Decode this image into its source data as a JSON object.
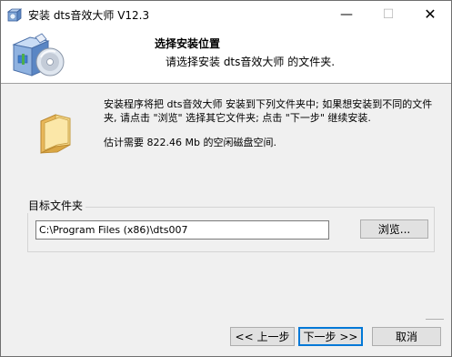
{
  "window": {
    "title": "安装 dts音效大师 V12.3",
    "minimize_glyph": "—",
    "maximize_glyph": "☐",
    "close_glyph": "✕"
  },
  "header": {
    "title": "选择安装位置",
    "subtitle": "请选择安装 dts音效大师 的文件夹."
  },
  "body": {
    "description": "安装程序将把 dts音效大师 安装到下列文件夹中; 如果想安装到不同的文件夹, 请点击 \"浏览\" 选择其它文件夹; 点击 \"下一步\" 继续安装.",
    "space_required": "估计需要 822.46 Mb 的空闲磁盘空间."
  },
  "destination": {
    "group_label": "目标文件夹",
    "path_value": "C:\\Program Files (x86)\\dts007",
    "browse_label": "浏览..."
  },
  "footer": {
    "back_label": "<< 上一步",
    "next_label": "下一步 >>",
    "cancel_label": "取消"
  },
  "icons": {
    "app": "installer-box-icon",
    "header": "installer-box-cd-icon",
    "folder": "folder-icon"
  }
}
